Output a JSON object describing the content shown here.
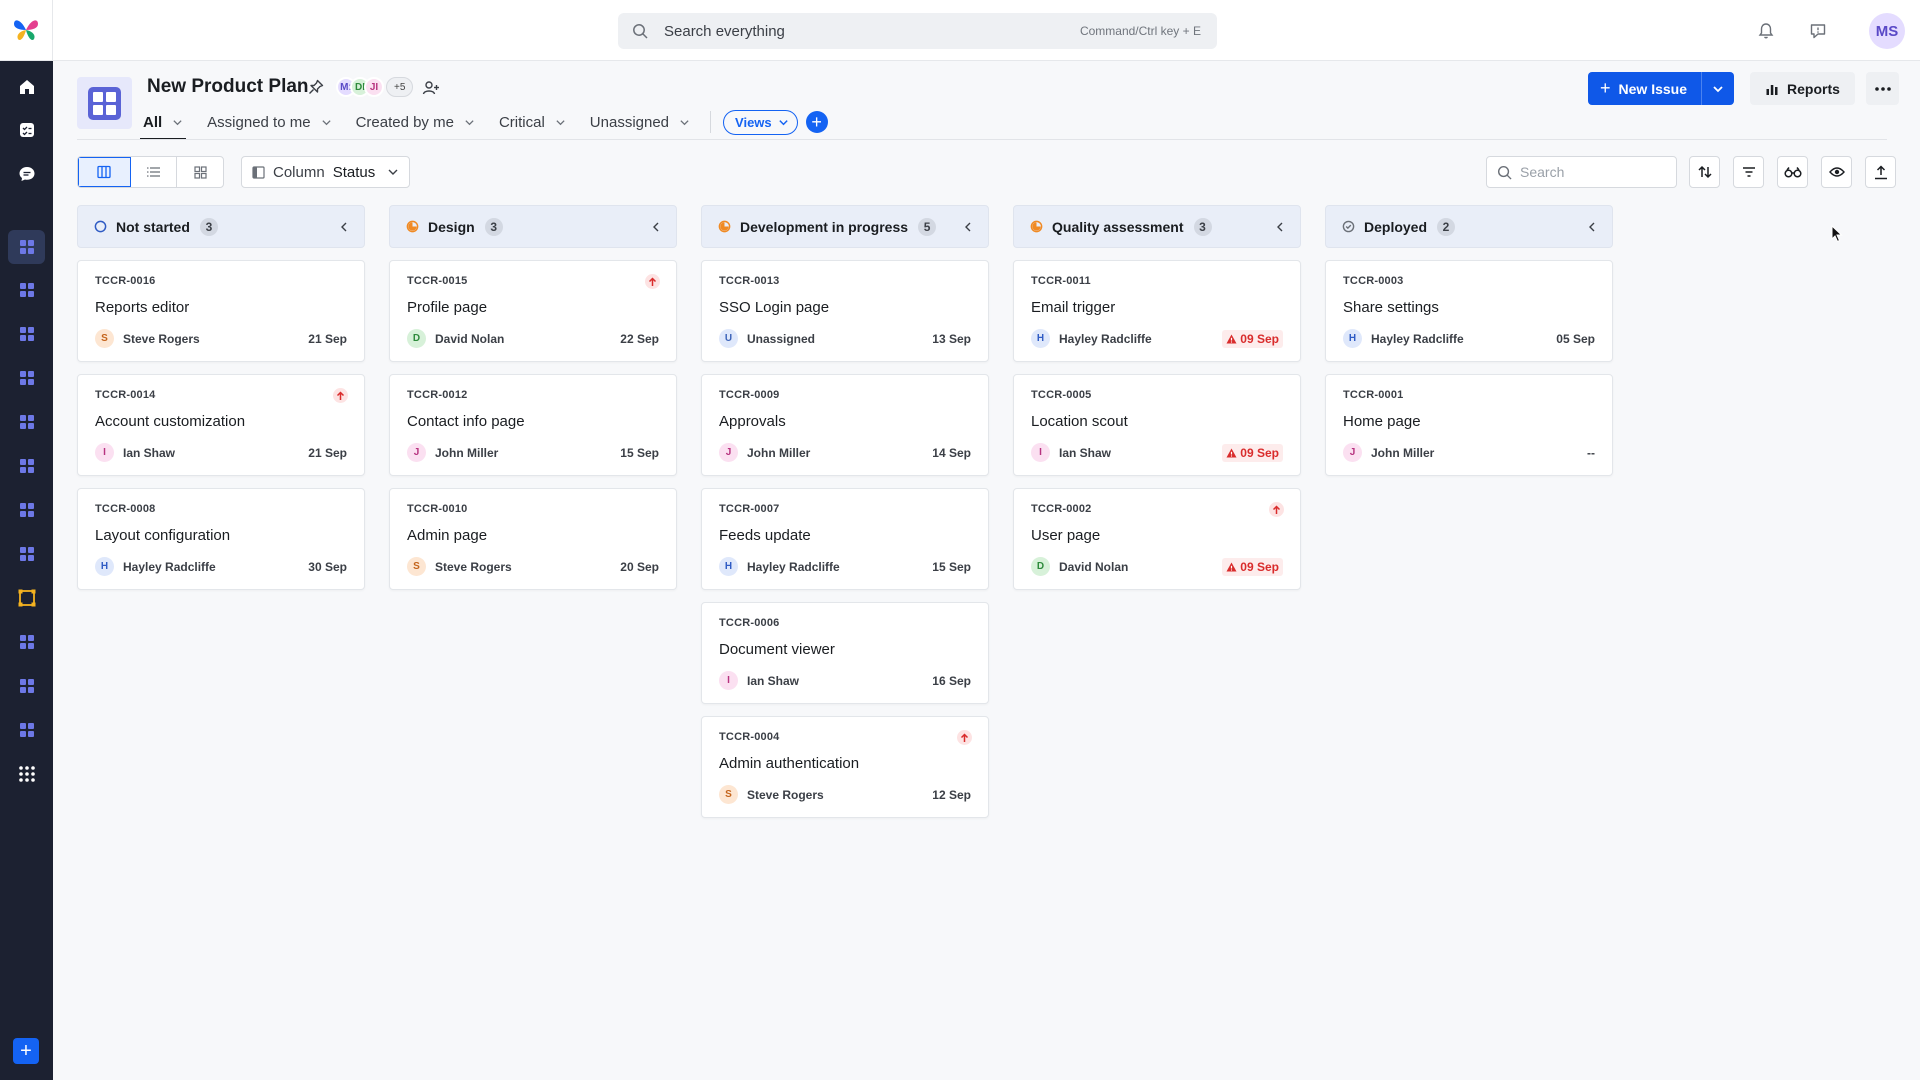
{
  "app": {
    "logo": "butterfly-logo"
  },
  "rail": {
    "items": [
      "home-icon",
      "tasks-icon",
      "chat-icon",
      "board-icon",
      "board-icon",
      "board-icon",
      "board-icon",
      "board-icon",
      "board-icon",
      "board-icon",
      "board-icon",
      "workflow-icon",
      "board-icon",
      "board-icon",
      "board-icon",
      "apps-grid-icon"
    ],
    "active_index": 3,
    "add_label": "+"
  },
  "topbar": {
    "search_placeholder": "Search everything",
    "search_hint": "Command/Ctrl key + E",
    "user_initials": "MS"
  },
  "project": {
    "title": "New Product Plan",
    "members": [
      {
        "initials": "M:",
        "bg": "#e4dcff",
        "fg": "#5a49c7"
      },
      {
        "initials": "DI",
        "bg": "#d7f1d9",
        "fg": "#2d8a3b"
      },
      {
        "initials": "JI",
        "bg": "#fbe0f1",
        "fg": "#b7337f"
      }
    ],
    "members_more": "+5"
  },
  "tabs": [
    {
      "label": "All",
      "active": true
    },
    {
      "label": "Assigned to me",
      "active": false
    },
    {
      "label": "Created by me",
      "active": false
    },
    {
      "label": "Critical",
      "active": false
    },
    {
      "label": "Unassigned",
      "active": false
    }
  ],
  "views_label": "Views",
  "actions": {
    "new_issue": "New Issue",
    "reports": "Reports"
  },
  "toolbar": {
    "group_label": "Column",
    "group_value": "Status",
    "search_placeholder": "Search"
  },
  "colors": {
    "accent": "#1463f3",
    "overdue": "#d92c2c",
    "in_progress": "#f08a24"
  },
  "columns": [
    {
      "name": "Not started",
      "count": "3",
      "status": "not-started",
      "cards": [
        {
          "key": "TCCR-0016",
          "title": "Reports editor",
          "initial": "S",
          "assignee": "Steve Rogers",
          "due": "21 Sep",
          "overdue": false,
          "priority": false
        },
        {
          "key": "TCCR-0014",
          "title": "Account customization",
          "initial": "I",
          "assignee": "Ian Shaw",
          "due": "21 Sep",
          "overdue": false,
          "priority": true
        },
        {
          "key": "TCCR-0008",
          "title": "Layout configuration",
          "initial": "H",
          "assignee": "Hayley Radcliffe",
          "due": "30 Sep",
          "overdue": false,
          "priority": false
        }
      ]
    },
    {
      "name": "Design",
      "count": "3",
      "status": "in-progress",
      "cards": [
        {
          "key": "TCCR-0015",
          "title": "Profile page",
          "initial": "D",
          "assignee": "David Nolan",
          "due": "22 Sep",
          "overdue": false,
          "priority": true
        },
        {
          "key": "TCCR-0012",
          "title": "Contact info page",
          "initial": "J",
          "assignee": "John Miller",
          "due": "15 Sep",
          "overdue": false,
          "priority": false
        },
        {
          "key": "TCCR-0010",
          "title": "Admin page",
          "initial": "S",
          "assignee": "Steve Rogers",
          "due": "20 Sep",
          "overdue": false,
          "priority": false
        }
      ]
    },
    {
      "name": "Development in progress",
      "count": "5",
      "status": "in-progress",
      "cards": [
        {
          "key": "TCCR-0013",
          "title": "SSO Login page",
          "initial": "U",
          "assignee": "Unassigned",
          "due": "13 Sep",
          "overdue": false,
          "priority": false
        },
        {
          "key": "TCCR-0009",
          "title": "Approvals",
          "initial": "J",
          "assignee": "John Miller",
          "due": "14 Sep",
          "overdue": false,
          "priority": false
        },
        {
          "key": "TCCR-0007",
          "title": "Feeds update",
          "initial": "H",
          "assignee": "Hayley Radcliffe",
          "due": "15 Sep",
          "overdue": false,
          "priority": false
        },
        {
          "key": "TCCR-0006",
          "title": "Document viewer",
          "initial": "I",
          "assignee": "Ian Shaw",
          "due": "16 Sep",
          "overdue": false,
          "priority": false
        },
        {
          "key": "TCCR-0004",
          "title": "Admin authentication",
          "initial": "S",
          "assignee": "Steve Rogers",
          "due": "12 Sep",
          "overdue": false,
          "priority": true
        }
      ]
    },
    {
      "name": "Quality assessment",
      "count": "3",
      "status": "in-progress",
      "cards": [
        {
          "key": "TCCR-0011",
          "title": "Email trigger",
          "initial": "H",
          "assignee": "Hayley Radcliffe",
          "due": "09 Sep",
          "overdue": true,
          "priority": false
        },
        {
          "key": "TCCR-0005",
          "title": "Location scout",
          "initial": "I",
          "assignee": "Ian Shaw",
          "due": "09 Sep",
          "overdue": true,
          "priority": false
        },
        {
          "key": "TCCR-0002",
          "title": "User page",
          "initial": "D",
          "assignee": "David Nolan",
          "due": "09 Sep",
          "overdue": true,
          "priority": true
        }
      ]
    },
    {
      "name": "Deployed",
      "count": "2",
      "status": "done",
      "cards": [
        {
          "key": "TCCR-0003",
          "title": "Share settings",
          "initial": "H",
          "assignee": "Hayley Radcliffe",
          "due": "05 Sep",
          "overdue": false,
          "priority": false
        },
        {
          "key": "TCCR-0001",
          "title": "Home page",
          "initial": "J",
          "assignee": "John Miller",
          "due": "--",
          "overdue": false,
          "priority": false
        }
      ]
    }
  ]
}
